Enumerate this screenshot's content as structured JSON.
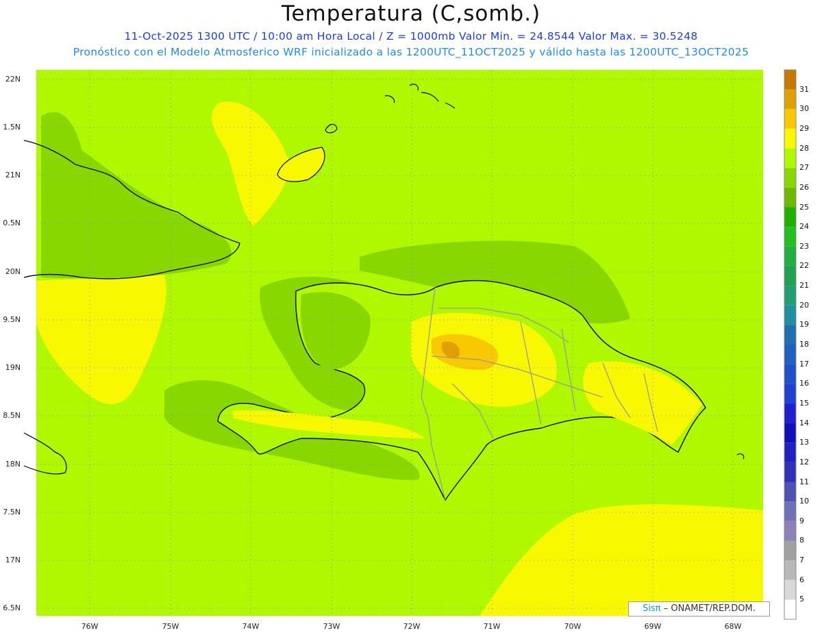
{
  "header": {
    "title": "Temperatura (C,somb.)",
    "line1": "11-Oct-2025 1300 UTC / 10:00 am Hora Local / Z = 1000mb  Valor Min. = 24.8544  Valor Max. = 30.5248",
    "line2": "Pronóstico con el Modelo Atmosferico WRF inicializado a las 1200UTC_11OCT2025 y válido hasta las  1200UTC_13OCT2025"
  },
  "axes": {
    "lat_ticks": [
      "22N",
      "1.5N",
      "21N",
      "0.5N",
      "20N",
      "9.5N",
      "19N",
      "8.5N",
      "18N",
      "7.5N",
      "17N",
      "6.5N"
    ],
    "lon_ticks": [
      "76W",
      "75W",
      "74W",
      "73W",
      "72W",
      "71W",
      "70W",
      "69W",
      "68W"
    ]
  },
  "colorbar": {
    "labels": [
      "31",
      "30",
      "29",
      "28",
      "27",
      "26",
      "25",
      "24",
      "23",
      "22",
      "21",
      "20",
      "19",
      "18",
      "17",
      "16",
      "15",
      "14",
      "13",
      "12",
      "11",
      "10",
      "9",
      "8",
      "7",
      "6",
      "5"
    ],
    "colors": [
      "#c87800",
      "#e0a000",
      "#f8c800",
      "#f8f800",
      "#b0f800",
      "#88d800",
      "#70b800",
      "#20b000",
      "#20c020",
      "#20b040",
      "#20a050",
      "#20a070",
      "#2090a0",
      "#2070b0",
      "#2060c0",
      "#2050c8",
      "#2040d0",
      "#2020d0",
      "#1010b8",
      "#2020c0",
      "#3030b8",
      "#5050b0",
      "#7070b8",
      "#9080b8",
      "#a0a0a0",
      "#b8b8b8",
      "#d8d8d8",
      "#ffffff"
    ]
  },
  "credit": {
    "sisp": "Sisπ",
    "text": "– ONAMET/REP.DOM."
  }
}
